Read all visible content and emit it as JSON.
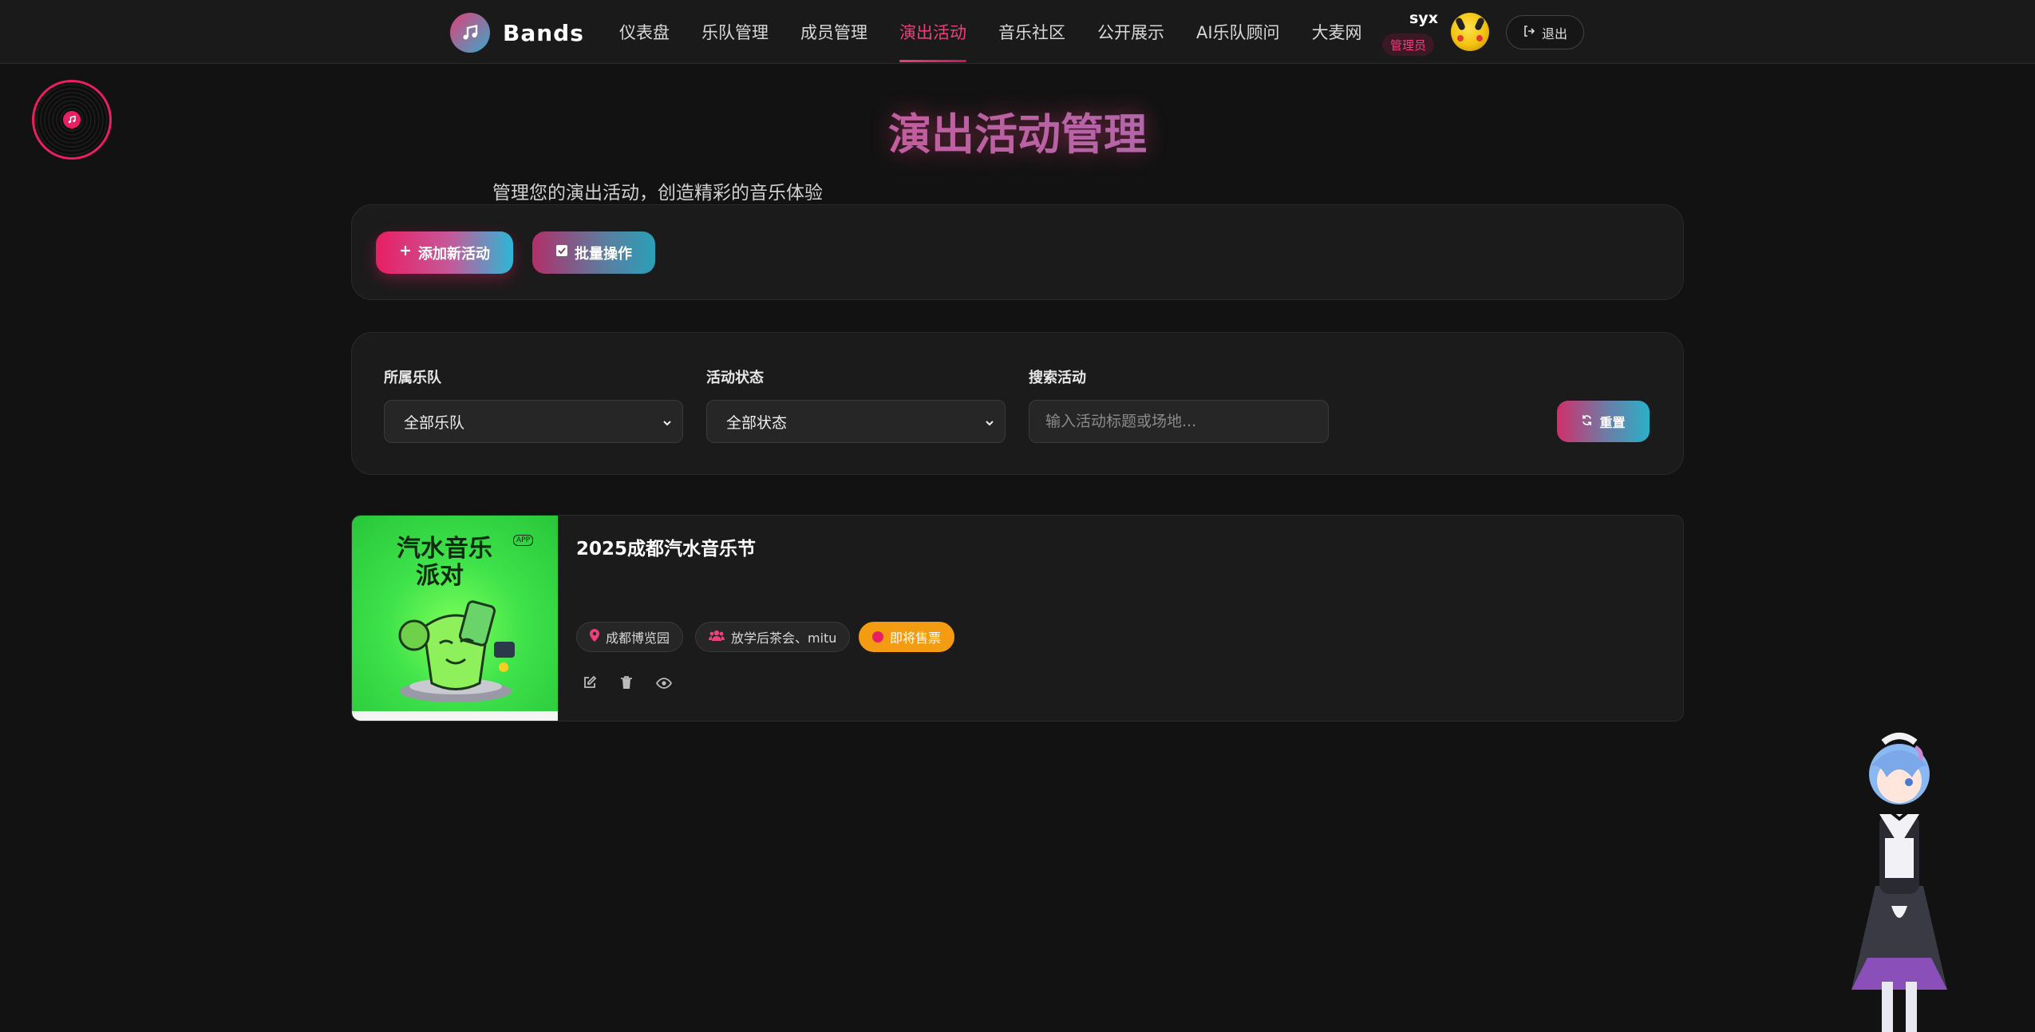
{
  "header": {
    "brand": "Bands",
    "nav": [
      {
        "label": "仪表盘",
        "active": false
      },
      {
        "label": "乐队管理",
        "active": false
      },
      {
        "label": "成员管理",
        "active": false
      },
      {
        "label": "演出活动",
        "active": true
      },
      {
        "label": "音乐社区",
        "active": false
      },
      {
        "label": "公开展示",
        "active": false
      },
      {
        "label": "AI乐队顾问",
        "active": false
      },
      {
        "label": "大麦网",
        "active": false
      }
    ],
    "user": {
      "name": "syx",
      "role": "管理员"
    },
    "logout_label": "退出"
  },
  "page": {
    "title": "演出活动管理",
    "subtitle": "管理您的演出活动，创造精彩的音乐体验"
  },
  "actions": {
    "add_label": "添加新活动",
    "batch_label": "批量操作"
  },
  "filters": {
    "band_label": "所属乐队",
    "band_value": "全部乐队",
    "status_label": "活动状态",
    "status_value": "全部状态",
    "search_label": "搜索活动",
    "search_placeholder": "输入活动标题或场地...",
    "reset_label": "重置"
  },
  "events": [
    {
      "title": "2025成都汽水音乐节",
      "venue": "成都博览园",
      "bands": "放学后茶会、mitu",
      "status": "即将售票",
      "poster": {
        "line1": "汽水音乐",
        "line2": "派对",
        "tag": "APP"
      }
    }
  ],
  "colors": {
    "accent": "#ec407a",
    "accent_blue": "#2bb8d6",
    "status_upcoming": "#f39c12",
    "background": "#121212",
    "panel": "#1b1b1b"
  },
  "icons": {
    "logout": "sign-out-icon",
    "add": "plus-icon",
    "batch": "check-square-icon",
    "reset": "refresh-icon",
    "venue": "map-pin-icon",
    "bands": "users-icon",
    "edit": "edit-icon",
    "delete": "trash-icon",
    "view": "eye-icon"
  }
}
